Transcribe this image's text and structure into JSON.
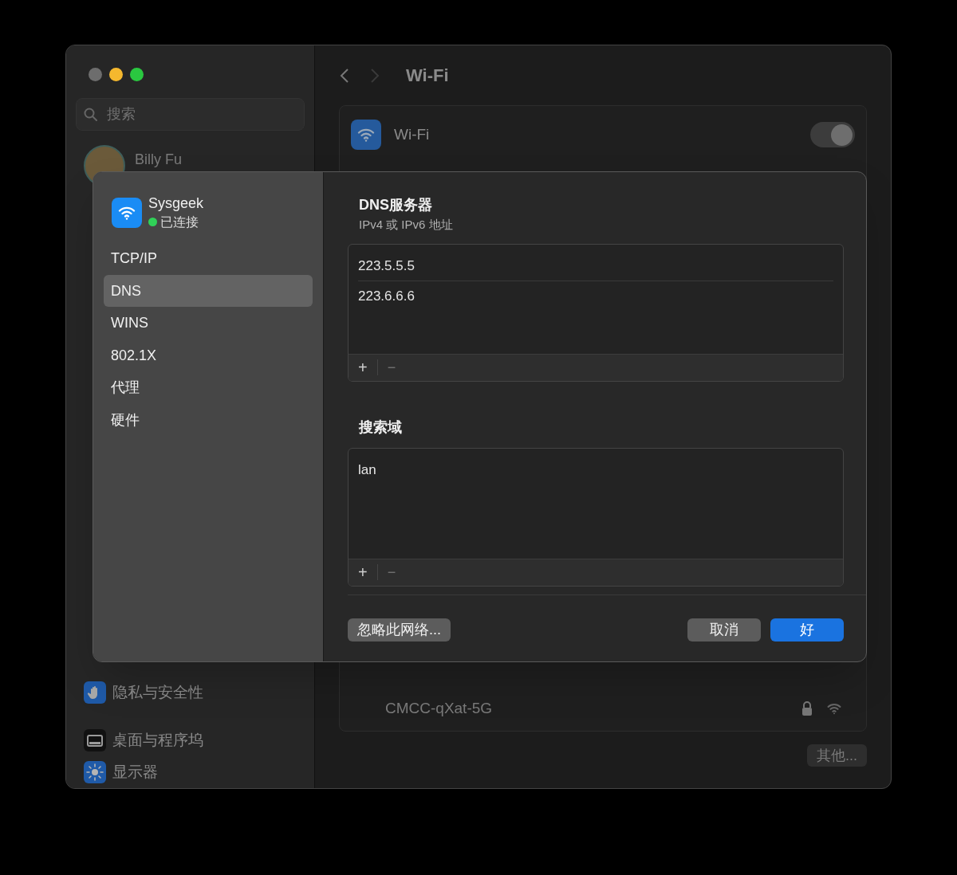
{
  "sidebar": {
    "search": {
      "placeholder": "搜索"
    },
    "user": {
      "name": "Billy Fu"
    },
    "items": [
      {
        "label": "隐私与安全性",
        "kind": "hand"
      },
      {
        "label": "桌面与程序坞",
        "kind": "dock"
      },
      {
        "label": "显示器",
        "kind": "sun"
      }
    ]
  },
  "header": {
    "title": "Wi-Fi"
  },
  "wifi_card": {
    "label": "Wi-Fi",
    "on": true
  },
  "networks": [
    {
      "name": "CMCC-qXat-5G",
      "locked": true
    }
  ],
  "other_button": "其他...",
  "sheet": {
    "network": {
      "name": "Sysgeek",
      "status": "已连接",
      "connected": true
    },
    "tabs": [
      {
        "label": "TCP/IP",
        "selected": false
      },
      {
        "label": "DNS",
        "selected": true
      },
      {
        "label": "WINS",
        "selected": false
      },
      {
        "label": "802.1X",
        "selected": false
      },
      {
        "label": "代理",
        "selected": false
      },
      {
        "label": "硬件",
        "selected": false
      }
    ],
    "dns": {
      "title": "DNS服务器",
      "subtitle": "IPv4 或 IPv6 地址",
      "entries": [
        "223.5.5.5",
        "223.6.6.6"
      ],
      "add": "+",
      "remove": "−"
    },
    "search_domains": {
      "title": "搜索域",
      "entries": [
        "lan"
      ],
      "add": "+",
      "remove": "−"
    },
    "buttons": {
      "forget": "忽略此网络...",
      "cancel": "取消",
      "ok": "好"
    }
  }
}
